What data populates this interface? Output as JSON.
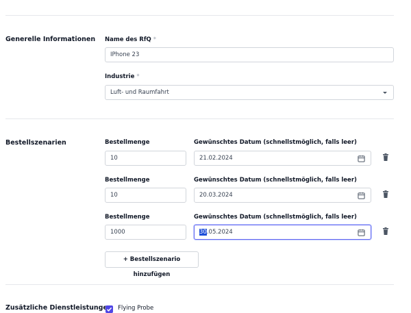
{
  "general": {
    "title": "Generelle Informationen",
    "rfq_name_label": "Name des RfQ",
    "rfq_name_value": "IPhone 23",
    "industry_label": "Industrie",
    "industry_value": "Luft- und Raumfahrt",
    "required_mark": "*"
  },
  "orders": {
    "title": "Bestellszenarien",
    "quantity_label": "Bestellmenge",
    "date_label": "Gewünschtes Datum (schnellstmöglich, falls leer)",
    "rows": [
      {
        "quantity": "10",
        "date": "21.02.2024"
      },
      {
        "quantity": "10",
        "date": "20.03.2024"
      },
      {
        "quantity": "1000",
        "date_selected": "30",
        "date_rest": ".05.2024"
      }
    ],
    "add_button": "+ Bestellszenario hinzufügen"
  },
  "extras": {
    "title": "Zusätzliche Dienstleistungen",
    "option_label": "Flying Probe",
    "option_checked": true
  },
  "colors": {
    "accent": "#4f46e5",
    "selection": "#1d4ed8",
    "border": "#d1d5db"
  },
  "icons": [
    "chevron-down-icon",
    "calendar-icon",
    "trash-icon",
    "check-icon"
  ]
}
